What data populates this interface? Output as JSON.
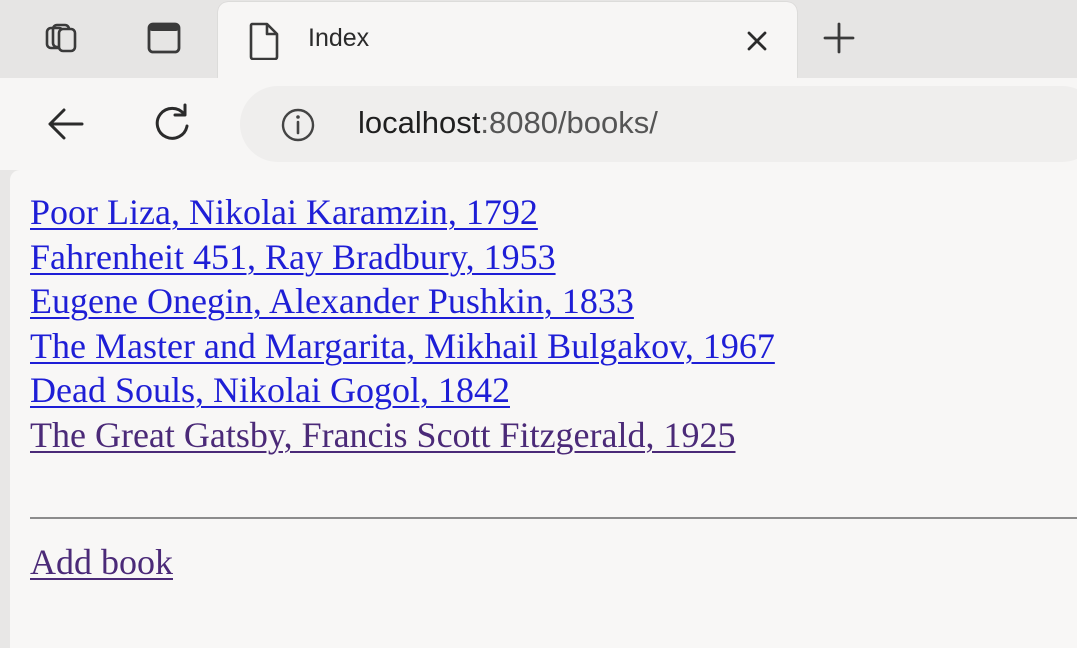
{
  "browser": {
    "tab": {
      "title": "Index",
      "icon": "page-icon"
    },
    "tabstrip_buttons": [
      "workspaces-icon",
      "vertical-tabs-icon",
      "new-tab-plus-icon"
    ],
    "toolbar_buttons": [
      "back-arrow-icon",
      "refresh-icon"
    ],
    "address_bar": {
      "host": "localhost",
      "rest": ":8080/books/",
      "icon": "info-icon"
    }
  },
  "page": {
    "books": [
      {
        "label": "Poor Liza, Nikolai Karamzin, 1792",
        "visited": false
      },
      {
        "label": "Fahrenheit 451, Ray Bradbury, 1953",
        "visited": false
      },
      {
        "label": "Eugene Onegin, Alexander Pushkin, 1833",
        "visited": false
      },
      {
        "label": "The Master and Margarita, Mikhail Bulgakov, 1967",
        "visited": false
      },
      {
        "label": "Dead Souls, Nikolai Gogol, 1842",
        "visited": false
      },
      {
        "label": "The Great Gatsby, Francis Scott Fitzgerald, 1925",
        "visited": true
      }
    ],
    "add_link": "Add book"
  },
  "colors": {
    "link": "#1e1ed6",
    "visited_link": "#4b2a78",
    "page_background": "#f8f7f6",
    "chrome_background": "#e6e5e4"
  }
}
